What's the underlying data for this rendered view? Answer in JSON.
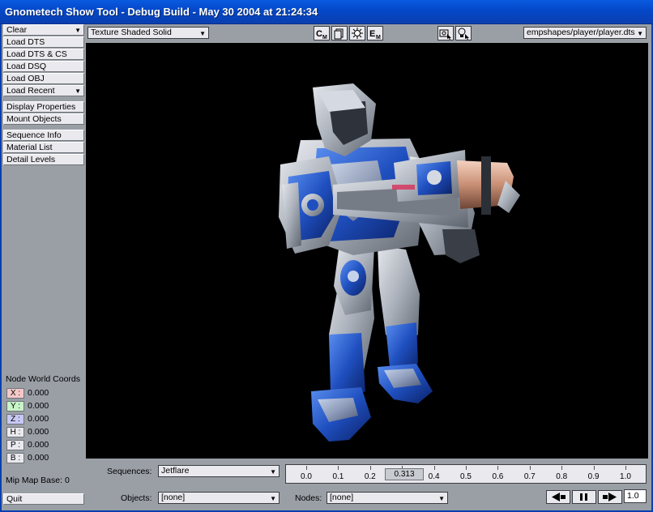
{
  "window": {
    "title": "Gnometech Show Tool - Debug Build - May 30 2004 at 21:24:34"
  },
  "sidebar": {
    "clear_label": "Clear",
    "load_dts": "Load DTS",
    "load_dts_cs": "Load DTS & CS",
    "load_dsq": "Load DSQ",
    "load_obj": "Load OBJ",
    "load_recent": "Load Recent",
    "display_properties": "Display Properties",
    "mount_objects": "Mount Objects",
    "sequence_info": "Sequence Info",
    "material_list": "Material List",
    "detail_levels": "Detail Levels",
    "coords_title": "Node World Coords",
    "coords": [
      {
        "label": "X :",
        "value": "0.000",
        "color": "#f4c8c8"
      },
      {
        "label": "Y :",
        "value": "0.000",
        "color": "#c8f4c8"
      },
      {
        "label": "Z :",
        "value": "0.000",
        "color": "#c8c8f4"
      },
      {
        "label": "H :",
        "value": "0.000",
        "color": "#e9e9ee"
      },
      {
        "label": "P :",
        "value": "0.000",
        "color": "#e9e9ee"
      },
      {
        "label": "B :",
        "value": "0.000",
        "color": "#e9e9ee"
      }
    ],
    "mipmap": "Mip Map Base: 0",
    "quit_label": "Quit"
  },
  "toolbar": {
    "render_mode": "Texture Shaded Solid",
    "buttons": [
      "C",
      "",
      "",
      "E"
    ],
    "file_path": "empshapes/player/player.dts"
  },
  "bottom": {
    "sequences_label": "Sequences:",
    "sequence_value": "Jetflare",
    "objects_label": "Objects:",
    "objects_value": "[none]",
    "nodes_label": "Nodes:",
    "nodes_value": "[none]",
    "timeline_ticks": [
      "0.0",
      "0.1",
      "0.2",
      "0.3",
      "0.4",
      "0.5",
      "0.6",
      "0.7",
      "0.8",
      "0.9",
      "1.0"
    ],
    "time_readout": "0.313",
    "speed_value": "1.0"
  },
  "colors": {
    "titlebar": "#0447c8",
    "panel": "#9a9fa6",
    "button": "#e9e9ee",
    "viewport": "#000000",
    "armor_blue": "#1f4fbf",
    "armor_grey": "#b9bfc8"
  },
  "icons": {
    "dropdown_arrow": "chevron-down-icon",
    "rewind": "rewind-icon",
    "pause": "pause-icon",
    "play": "play-icon"
  }
}
